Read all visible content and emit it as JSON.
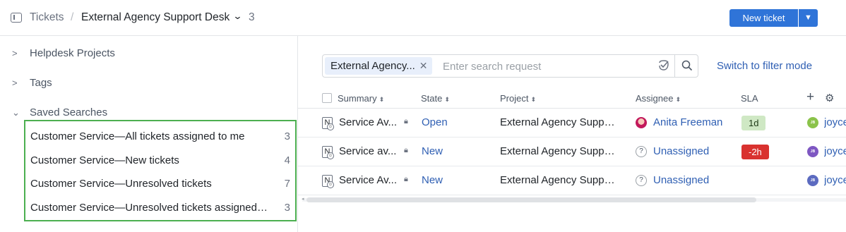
{
  "header": {
    "breadcrumb_root": "Tickets",
    "breadcrumb_sep": "/",
    "project_name": "External Agency Support Desk",
    "ticket_count": "3",
    "new_ticket_label": "New ticket"
  },
  "sidebar": {
    "tree": [
      {
        "label": "Helpdesk Projects"
      },
      {
        "label": "Tags"
      },
      {
        "label": "Saved Searches"
      }
    ],
    "saved_searches": [
      {
        "label": "Customer Service—All tickets assigned to me",
        "count": "3"
      },
      {
        "label": "Customer Service—New tickets",
        "count": "4"
      },
      {
        "label": "Customer Service—Unresolved tickets",
        "count": "7"
      },
      {
        "label": "Customer Service—Unresolved tickets assigned to me",
        "count": "3"
      }
    ]
  },
  "search": {
    "chip_label": "External Agency...",
    "placeholder": "Enter search request",
    "value": "",
    "switch_mode_label": "Switch to filter mode"
  },
  "table": {
    "columns": {
      "summary": "Summary",
      "state": "State",
      "project": "Project",
      "assignee": "Assignee",
      "sla": "SLA"
    },
    "rows": [
      {
        "type": "N",
        "summary": "Service Av...",
        "state": "Open",
        "project": "External Agency Support Desk",
        "assignee": "Anita Freeman",
        "sla": "1d",
        "sla_status": "ok",
        "reporter": "joyce",
        "reporter_initials": "JB"
      },
      {
        "type": "N",
        "summary": "Service av...",
        "state": "New",
        "project": "External Agency Support Desk",
        "assignee": "Unassigned",
        "sla": "-2h",
        "sla_status": "breached",
        "reporter": "joyce",
        "reporter_initials": "JB"
      },
      {
        "type": "N",
        "summary": "Service Av...",
        "state": "New",
        "project": "External Agency Support Desk",
        "assignee": "Unassigned",
        "sla": "",
        "sla_status": "none",
        "reporter": "joyce",
        "reporter_initials": "JB"
      }
    ]
  },
  "colors": {
    "accent": "#2f74d8",
    "link": "#2f5fb3",
    "highlight_box": "#4caf50",
    "sla_ok": "#cfe8c4",
    "sla_breached": "#d9322f"
  }
}
